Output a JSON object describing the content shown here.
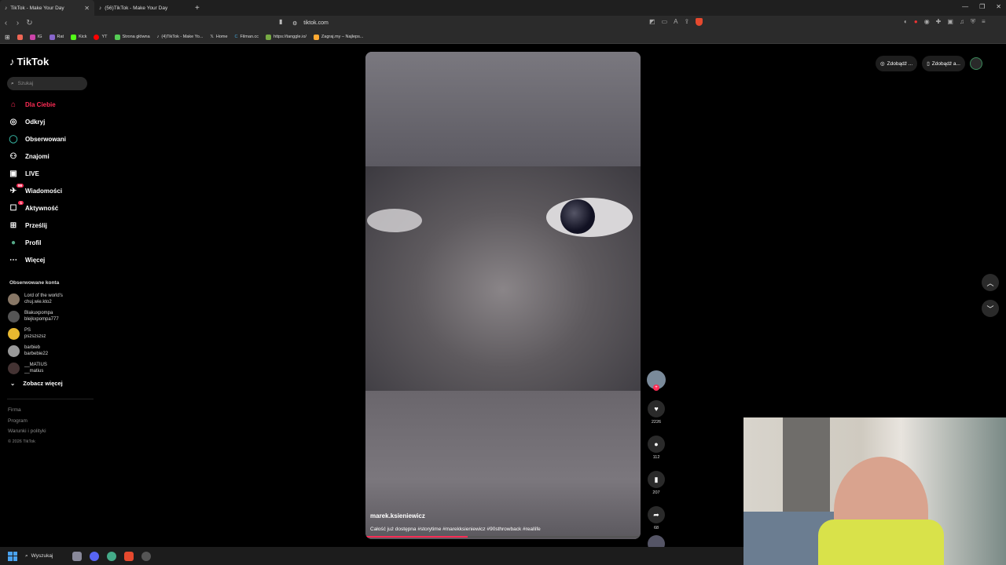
{
  "browser": {
    "tabs": [
      {
        "title": "TikTok - Make Your Day",
        "active": true
      },
      {
        "title": "(56)TikTok - Make Your Day",
        "active": false
      }
    ],
    "url": "tiktok.com",
    "bookmarks": [
      "IG",
      "Rat",
      "Kick",
      "YT",
      "Strona główna",
      "(4)TikTok - Make Yo...",
      "Home",
      "Filman.cc",
      "https://tanggle.io/",
      "Zagraj.my – Najleps..."
    ]
  },
  "sidebar": {
    "logo": "TikTok",
    "search_placeholder": "Szukaj",
    "nav": [
      {
        "label": "Dla Ciebie",
        "icon": "home-icon"
      },
      {
        "label": "Odkryj",
        "icon": "compass-icon"
      },
      {
        "label": "Obserwowani",
        "icon": "following-icon"
      },
      {
        "label": "Znajomi",
        "icon": "friends-icon"
      },
      {
        "label": "LIVE",
        "icon": "live-icon"
      },
      {
        "label": "Wiadomości",
        "icon": "messages-icon",
        "badge": "99"
      },
      {
        "label": "Aktywność",
        "icon": "activity-icon",
        "badge": "1"
      },
      {
        "label": "Prześlij",
        "icon": "upload-icon"
      },
      {
        "label": "Profil",
        "icon": "profile-icon"
      },
      {
        "label": "Więcej",
        "icon": "more-icon"
      }
    ],
    "following_title": "Obserwowane konta",
    "following": [
      {
        "name": "Lord of the world's",
        "handle": "chuj.wie.kto2"
      },
      {
        "name": "Blakuxpompa",
        "handle": "blejkxpompa777"
      },
      {
        "name": "PS",
        "handle": "pszszszsz"
      },
      {
        "name": "barbieb",
        "handle": "barbebie22"
      },
      {
        "name": "__MATIUS",
        "handle": "__matius"
      }
    ],
    "see_more": "Zobacz więcej",
    "footer": [
      "Firma",
      "Program",
      "Warunki i polityki"
    ],
    "copyright": "© 2026 TikTok"
  },
  "video": {
    "author": "marek.ksieniewicz",
    "caption": "Całość już dostępna #storytime #marekksieniewicz #90sthrowback #reallife",
    "progress": 0.37
  },
  "actions": {
    "likes": "2226",
    "comments": "112",
    "saves": "207",
    "shares": "68"
  },
  "topbar": {
    "get_coins": "Zdobądź ...",
    "get_app": "Zdobądź a..."
  },
  "taskbar": {
    "search_label": "Wyszukaj"
  }
}
